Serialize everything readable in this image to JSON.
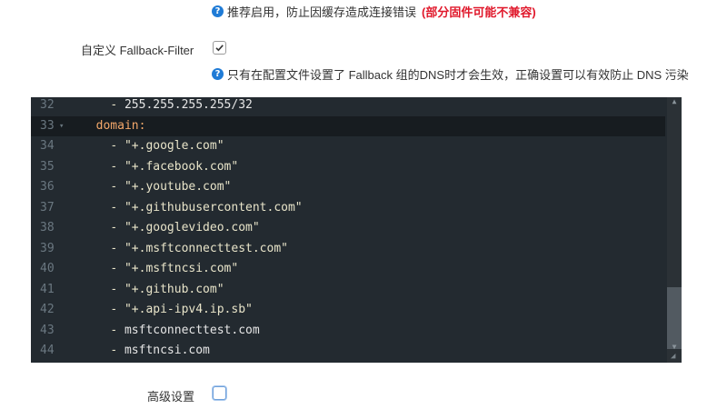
{
  "top_help": {
    "text": "推荐启用，防止因缓存造成连接错误",
    "warning": "(部分固件可能不兼容)"
  },
  "fallback_filter": {
    "label": "自定义 Fallback-Filter",
    "checked": true,
    "help": "只有在配置文件设置了 Fallback 组的DNS时才会生效，正确设置可以有效防止 DNS 污染"
  },
  "editor": {
    "lines": [
      {
        "num": "32",
        "indent": "    ",
        "dash": "- ",
        "text": "255.255.255.255/32",
        "type": "plain",
        "fold": ""
      },
      {
        "num": "33",
        "indent": "  ",
        "dash": "",
        "text": "domain:",
        "type": "key",
        "fold": "▾"
      },
      {
        "num": "34",
        "indent": "    ",
        "dash": "- ",
        "text": "\"+.google.com\"",
        "type": "str",
        "fold": ""
      },
      {
        "num": "35",
        "indent": "    ",
        "dash": "- ",
        "text": "\"+.facebook.com\"",
        "type": "str",
        "fold": ""
      },
      {
        "num": "36",
        "indent": "    ",
        "dash": "- ",
        "text": "\"+.youtube.com\"",
        "type": "str",
        "fold": ""
      },
      {
        "num": "37",
        "indent": "    ",
        "dash": "- ",
        "text": "\"+.githubusercontent.com\"",
        "type": "str",
        "fold": ""
      },
      {
        "num": "38",
        "indent": "    ",
        "dash": "- ",
        "text": "\"+.googlevideo.com\"",
        "type": "str",
        "fold": ""
      },
      {
        "num": "39",
        "indent": "    ",
        "dash": "- ",
        "text": "\"+.msftconnecttest.com\"",
        "type": "str",
        "fold": ""
      },
      {
        "num": "40",
        "indent": "    ",
        "dash": "- ",
        "text": "\"+.msftncsi.com\"",
        "type": "str",
        "fold": ""
      },
      {
        "num": "41",
        "indent": "    ",
        "dash": "- ",
        "text": "\"+.github.com\"",
        "type": "str",
        "fold": ""
      },
      {
        "num": "42",
        "indent": "    ",
        "dash": "- ",
        "text": "\"+.api-ipv4.ip.sb\"",
        "type": "str",
        "fold": ""
      },
      {
        "num": "43",
        "indent": "    ",
        "dash": "- ",
        "text": "msftconnecttest.com",
        "type": "plain",
        "fold": ""
      },
      {
        "num": "44",
        "indent": "    ",
        "dash": "- ",
        "text": "msftncsi.com",
        "type": "plain",
        "fold": ""
      }
    ],
    "active_line": "33"
  },
  "advanced": {
    "label": "高级设置",
    "checked": false
  },
  "icons": {
    "help": "help-circle-icon",
    "check": "check-icon",
    "fold": "fold-arrow-icon",
    "resize": "resize-grip-icon"
  },
  "colors": {
    "accent": "#1f7bd6",
    "warning": "#e0182b",
    "editor_bg": "#232a30",
    "yaml_key": "#f4a86a"
  }
}
